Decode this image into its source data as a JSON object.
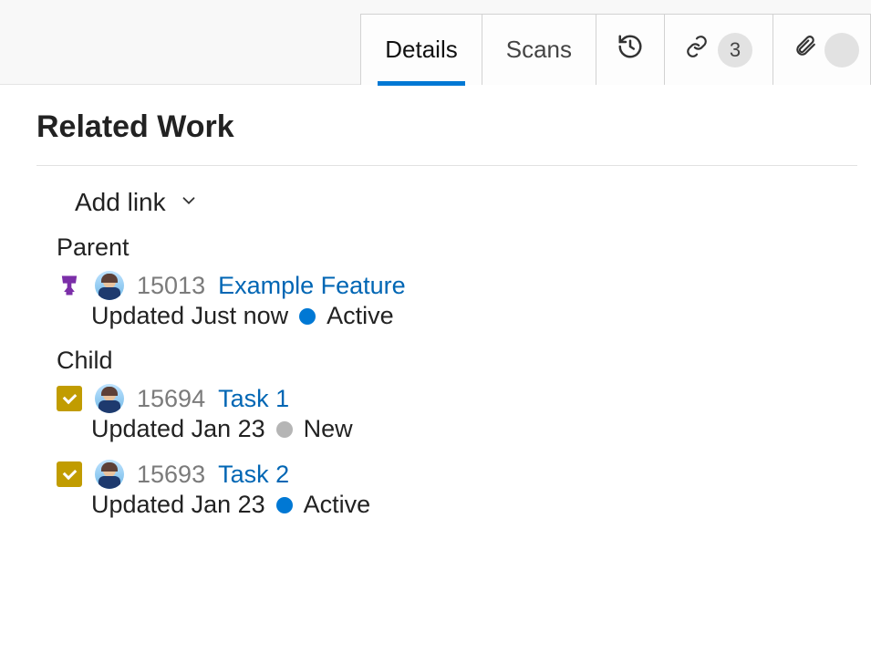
{
  "tabs": {
    "details": "Details",
    "scans": "Scans",
    "links_count": "3"
  },
  "section": {
    "title": "Related Work"
  },
  "addlink": {
    "label": "Add link"
  },
  "groups": {
    "parent": "Parent",
    "child": "Child"
  },
  "items": {
    "parent1": {
      "id": "15013",
      "title": "Example Feature",
      "updated": "Updated Just now",
      "state": "Active"
    },
    "child1": {
      "id": "15694",
      "title": "Task 1",
      "updated": "Updated Jan 23",
      "state": "New"
    },
    "child2": {
      "id": "15693",
      "title": "Task 2",
      "updated": "Updated Jan 23",
      "state": "Active"
    }
  }
}
